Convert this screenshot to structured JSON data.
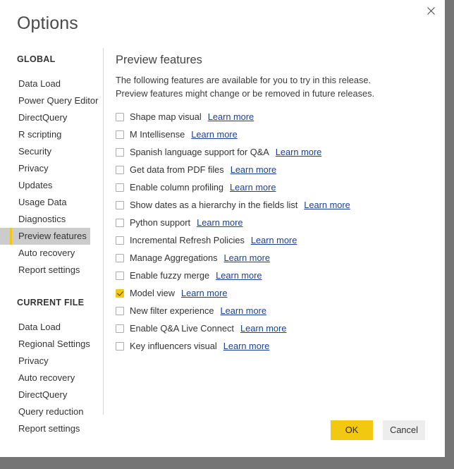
{
  "window": {
    "title": "Options",
    "close_icon": "close-icon"
  },
  "sidebar": {
    "groups": [
      {
        "title": "GLOBAL",
        "items": [
          {
            "label": "Data Load",
            "selected": false
          },
          {
            "label": "Power Query Editor",
            "selected": false
          },
          {
            "label": "DirectQuery",
            "selected": false
          },
          {
            "label": "R scripting",
            "selected": false
          },
          {
            "label": "Security",
            "selected": false
          },
          {
            "label": "Privacy",
            "selected": false
          },
          {
            "label": "Updates",
            "selected": false
          },
          {
            "label": "Usage Data",
            "selected": false
          },
          {
            "label": "Diagnostics",
            "selected": false
          },
          {
            "label": "Preview features",
            "selected": true
          },
          {
            "label": "Auto recovery",
            "selected": false
          },
          {
            "label": "Report settings",
            "selected": false
          }
        ]
      },
      {
        "title": "CURRENT FILE",
        "items": [
          {
            "label": "Data Load",
            "selected": false
          },
          {
            "label": "Regional Settings",
            "selected": false
          },
          {
            "label": "Privacy",
            "selected": false
          },
          {
            "label": "Auto recovery",
            "selected": false
          },
          {
            "label": "DirectQuery",
            "selected": false
          },
          {
            "label": "Query reduction",
            "selected": false
          },
          {
            "label": "Report settings",
            "selected": false
          }
        ]
      }
    ]
  },
  "content": {
    "heading": "Preview features",
    "description": "The following features are available for you to try in this release. Preview features might change or be removed in future releases.",
    "learn_more_label": "Learn more",
    "features": [
      {
        "label": "Shape map visual",
        "checked": false
      },
      {
        "label": "M Intellisense",
        "checked": false
      },
      {
        "label": "Spanish language support for Q&A",
        "checked": false
      },
      {
        "label": "Get data from PDF files",
        "checked": false
      },
      {
        "label": "Enable column profiling",
        "checked": false
      },
      {
        "label": "Show dates as a hierarchy in the fields list",
        "checked": false
      },
      {
        "label": "Python support",
        "checked": false
      },
      {
        "label": "Incremental Refresh Policies",
        "checked": false
      },
      {
        "label": "Manage Aggregations",
        "checked": false
      },
      {
        "label": "Enable fuzzy merge",
        "checked": false
      },
      {
        "label": "Model view",
        "checked": true
      },
      {
        "label": "New filter experience",
        "checked": false
      },
      {
        "label": "Enable Q&A Live Connect",
        "checked": false
      },
      {
        "label": "Key influencers visual",
        "checked": false
      }
    ]
  },
  "footer": {
    "ok_label": "OK",
    "cancel_label": "Cancel"
  },
  "colors": {
    "accent": "#f2c811",
    "link": "#1b3f94",
    "selected_bg": "#cccccc",
    "backdrop": "#757575"
  }
}
